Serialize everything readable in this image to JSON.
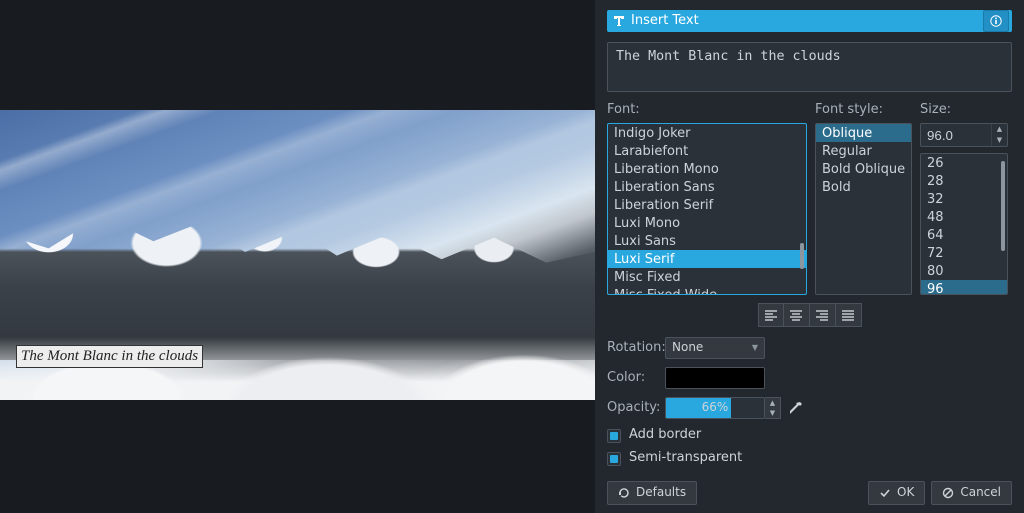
{
  "titlebar": {
    "title": "Insert Text"
  },
  "text_input": {
    "value": "The Mont Blanc in the clouds"
  },
  "overlay_text": "The Mont Blanc in the clouds",
  "labels": {
    "font": "Font:",
    "font_style": "Font style:",
    "size": "Size:"
  },
  "fonts": {
    "items": [
      "Indigo Joker",
      "Larabiefont",
      "Liberation Mono",
      "Liberation Sans",
      "Liberation Serif",
      "Luxi Mono",
      "Luxi Sans",
      "Luxi Serif",
      "Misc Fixed",
      "Misc Fixed Wide"
    ],
    "selected": "Luxi Serif"
  },
  "styles": {
    "items": [
      "Oblique",
      "Regular",
      "Bold Oblique",
      "Bold"
    ],
    "selected": "Oblique"
  },
  "size": {
    "value": "96.0",
    "presets": [
      "26",
      "28",
      "32",
      "48",
      "64",
      "72",
      "80",
      "96"
    ],
    "selected": "96"
  },
  "rotation": {
    "label": "Rotation:",
    "value": "None"
  },
  "color": {
    "label": "Color:",
    "hex": "#000000"
  },
  "opacity": {
    "label": "Opacity:",
    "value_text": "66%",
    "percent": 66
  },
  "checks": {
    "border": {
      "label": "Add border",
      "checked": true
    },
    "semi": {
      "label": "Semi-transparent",
      "checked": true
    }
  },
  "buttons": {
    "defaults": "Defaults",
    "ok": "OK",
    "cancel": "Cancel"
  }
}
